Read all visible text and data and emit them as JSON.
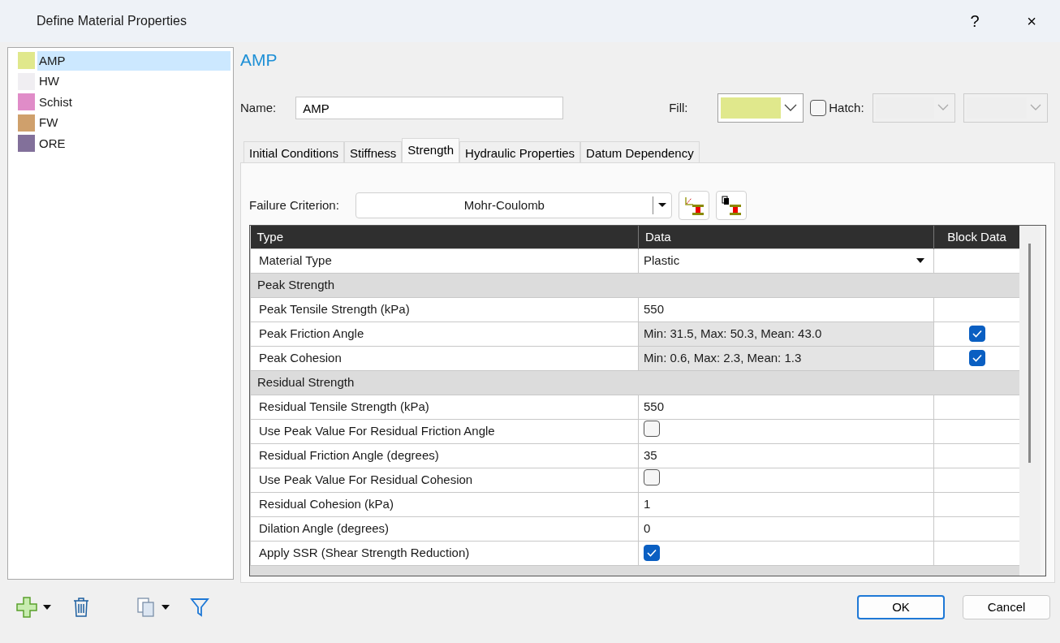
{
  "window": {
    "title": "Define Material Properties",
    "help": "?",
    "close": "×"
  },
  "materials": [
    {
      "name": "AMP",
      "color": "#e0e88c",
      "selected": true
    },
    {
      "name": "HW",
      "color": "#f0eef2",
      "selected": false
    },
    {
      "name": "Schist",
      "color": "#e08cc8",
      "selected": false
    },
    {
      "name": "FW",
      "color": "#cfa06c",
      "selected": false
    },
    {
      "name": "ORE",
      "color": "#82709a",
      "selected": false
    }
  ],
  "material_title": "AMP",
  "name": {
    "label": "Name:",
    "value": "AMP"
  },
  "fill": {
    "label": "Fill:",
    "color": "#e0e88c"
  },
  "hatch": {
    "label": "Hatch:",
    "checked": false
  },
  "tabs": [
    {
      "label": "Initial Conditions",
      "selected": false
    },
    {
      "label": "Stiffness",
      "selected": false
    },
    {
      "label": "Strength",
      "selected": true
    },
    {
      "label": "Hydraulic Properties",
      "selected": false
    },
    {
      "label": "Datum Dependency",
      "selected": false
    }
  ],
  "failure_criterion": {
    "label": "Failure Criterion:",
    "value": "Mohr-Coulomb"
  },
  "table": {
    "columns": [
      "Type",
      "Data",
      "Block Data"
    ],
    "rows": [
      {
        "kind": "dropdown",
        "type": "Material Type",
        "data": "Plastic"
      },
      {
        "kind": "section",
        "type": "Peak Strength"
      },
      {
        "kind": "text",
        "type": "Peak Tensile Strength (kPa)",
        "data": "550"
      },
      {
        "kind": "text",
        "type": "Peak Friction Angle",
        "data": "Min: 31.5, Max: 50.3, Mean: 43.0",
        "block_checked": true
      },
      {
        "kind": "text",
        "type": "Peak Cohesion",
        "data": "Min: 0.6, Max: 2.3, Mean: 1.3",
        "block_checked": true
      },
      {
        "kind": "section",
        "type": "Residual Strength"
      },
      {
        "kind": "text",
        "type": "Residual Tensile Strength (kPa)",
        "data": "550"
      },
      {
        "kind": "checkbox",
        "type": "Use Peak Value For Residual Friction Angle",
        "checked": false
      },
      {
        "kind": "text",
        "type": "Residual Friction Angle (degrees)",
        "data": "35"
      },
      {
        "kind": "checkbox",
        "type": "Use Peak Value For Residual Cohesion",
        "checked": false
      },
      {
        "kind": "text",
        "type": "Residual Cohesion (kPa)",
        "data": "1"
      },
      {
        "kind": "text",
        "type": "Dilation Angle (degrees)",
        "data": "0"
      },
      {
        "kind": "checkbox",
        "type": "Apply SSR (Shear Strength Reduction)",
        "checked": true
      }
    ]
  },
  "buttons": [
    {
      "label": "OK",
      "default": true
    },
    {
      "label": "Cancel",
      "default": false
    }
  ]
}
